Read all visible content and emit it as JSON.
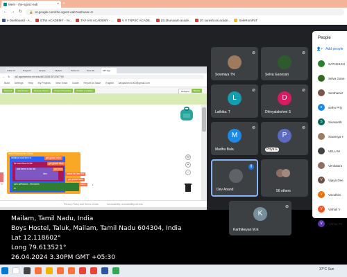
{
  "browser": {
    "tab_title": "Meet - rhe-sgvsz-eab",
    "new_tab_symbol": "+",
    "url": "et.google.com/rhe-sgvsz-eab?authuser=0",
    "bookmarks": [
      {
        "label": "e Dashboard - A...",
        "color": "#3b5998"
      },
      {
        "label": "ETW ACADEMY - Yo...",
        "color": "#e53935"
      },
      {
        "label": "TAF IAS ACADEMY - ...",
        "color": "#e53935"
      },
      {
        "label": "V V TNPSC ACADE...",
        "color": "#e53935"
      },
      {
        "label": "(3) dhuruvam acade...",
        "color": "#e53935"
      },
      {
        "label": "(7) suresh ias acade...",
        "color": "#e53935"
      },
      {
        "label": "SeleRomPaT",
        "color": "#fbbc04"
      }
    ]
  },
  "shared_screen": {
    "tabs": [
      "Folder Pr",
      "Pooja ID",
      "sample",
      "Flipkart",
      "Online D",
      "New tab",
      "MIT App"
    ],
    "url": "ai2.appinventor.mit.edu/#6124831572267793",
    "ai_menu": [
      "Build",
      "Settings",
      "Help",
      "My Projects",
      "View Trash",
      "Guide",
      "Report an Issue",
      "English",
      "sarojadhevi1000@gmail.com"
    ],
    "toolbar": [
      "Screen1",
      "Add Screen",
      "Remove Screen",
      "Project Properties",
      "Publish to Gallery"
    ],
    "designer_label": "Designer",
    "blocks_label": "Blocks",
    "blocks": {
      "event": "when Frameworks Clicks",
      "line1": "initialize local  item  to",
      "line2": "for each  item  in list",
      "line3": "add items to list  list",
      "line4": "item",
      "line5": "set  ListPicker1  . Elements",
      "line6": "to",
      "get_global_table": "get  global table",
      "get_item": "get  item",
      "select_list_item": "select list item  list",
      "index": "index",
      "index_val": "1"
    },
    "footer": [
      "Privacy Policy and Terms of Use",
      "Accessibility: accessibility.mit.edu"
    ],
    "warnings_label": "Show Warnings"
  },
  "geotag": {
    "line1": "Mailam, Tamil Nadu, India",
    "line2": "Boys Hostel, Taluk, Mailam, Tamil Nadu 604304, India",
    "line3": "Lat 12.118602°",
    "line4": "Long 79.613521°",
    "line5": "26.04.2024 3.30PM GMT +05:30"
  },
  "tiles": [
    {
      "name": "Sowmiya TN",
      "initial": "",
      "color": "#9e7b5f"
    },
    {
      "name": "Selva Ganesan",
      "initial": "",
      "color": "#2e5a2e"
    },
    {
      "name": "Lathika. T",
      "initial": "L",
      "color": "#129eaf"
    },
    {
      "name": "Dhivyalakshmi S",
      "initial": "D",
      "color": "#d81b60"
    },
    {
      "name": "Madhu Bala",
      "initial": "M",
      "color": "#1e88e5"
    },
    {
      "name": "Priya E",
      "initial": "P",
      "color": "#5c6bc0"
    },
    {
      "name": "Dev Anand",
      "initial": "",
      "color": "#5f6368"
    },
    {
      "name": "56 others",
      "initial": "",
      "color": "#5f6368"
    },
    {
      "name": "Karthikeyan M.E",
      "initial": "K",
      "color": "#78909c"
    }
  ],
  "people_panel": {
    "title": "People",
    "add_label": "Add people",
    "members": [
      {
        "name": "SATHEESH",
        "initial": "",
        "color": "#2e7d32"
      },
      {
        "name": "Selva Gane",
        "initial": "",
        "color": "#33691e"
      },
      {
        "name": "Senthamiz",
        "initial": "",
        "color": "#795548"
      },
      {
        "name": "sethu Priy",
        "initial": "s",
        "color": "#1e88e5"
      },
      {
        "name": "Sivasanth",
        "initial": "S",
        "color": "#00695c"
      },
      {
        "name": "Sowmiya T",
        "initial": "",
        "color": "#9e7b5f"
      },
      {
        "name": "VELU M",
        "initial": "",
        "color": "#424242"
      },
      {
        "name": "Venkatara",
        "initial": "",
        "color": "#8d6e63"
      },
      {
        "name": "Vijaya Dee",
        "initial": "V",
        "color": "#6d4c41"
      },
      {
        "name": "Vinodhini",
        "initial": "V",
        "color": "#ef6c00"
      },
      {
        "name": "Vishali V",
        "initial": "V",
        "color": "#f4511e"
      },
      {
        "name": "Vishnu Pri",
        "initial": "V",
        "color": "#5e35b1"
      }
    ]
  },
  "taskbar": {
    "tray_text": "37°C Sun"
  }
}
